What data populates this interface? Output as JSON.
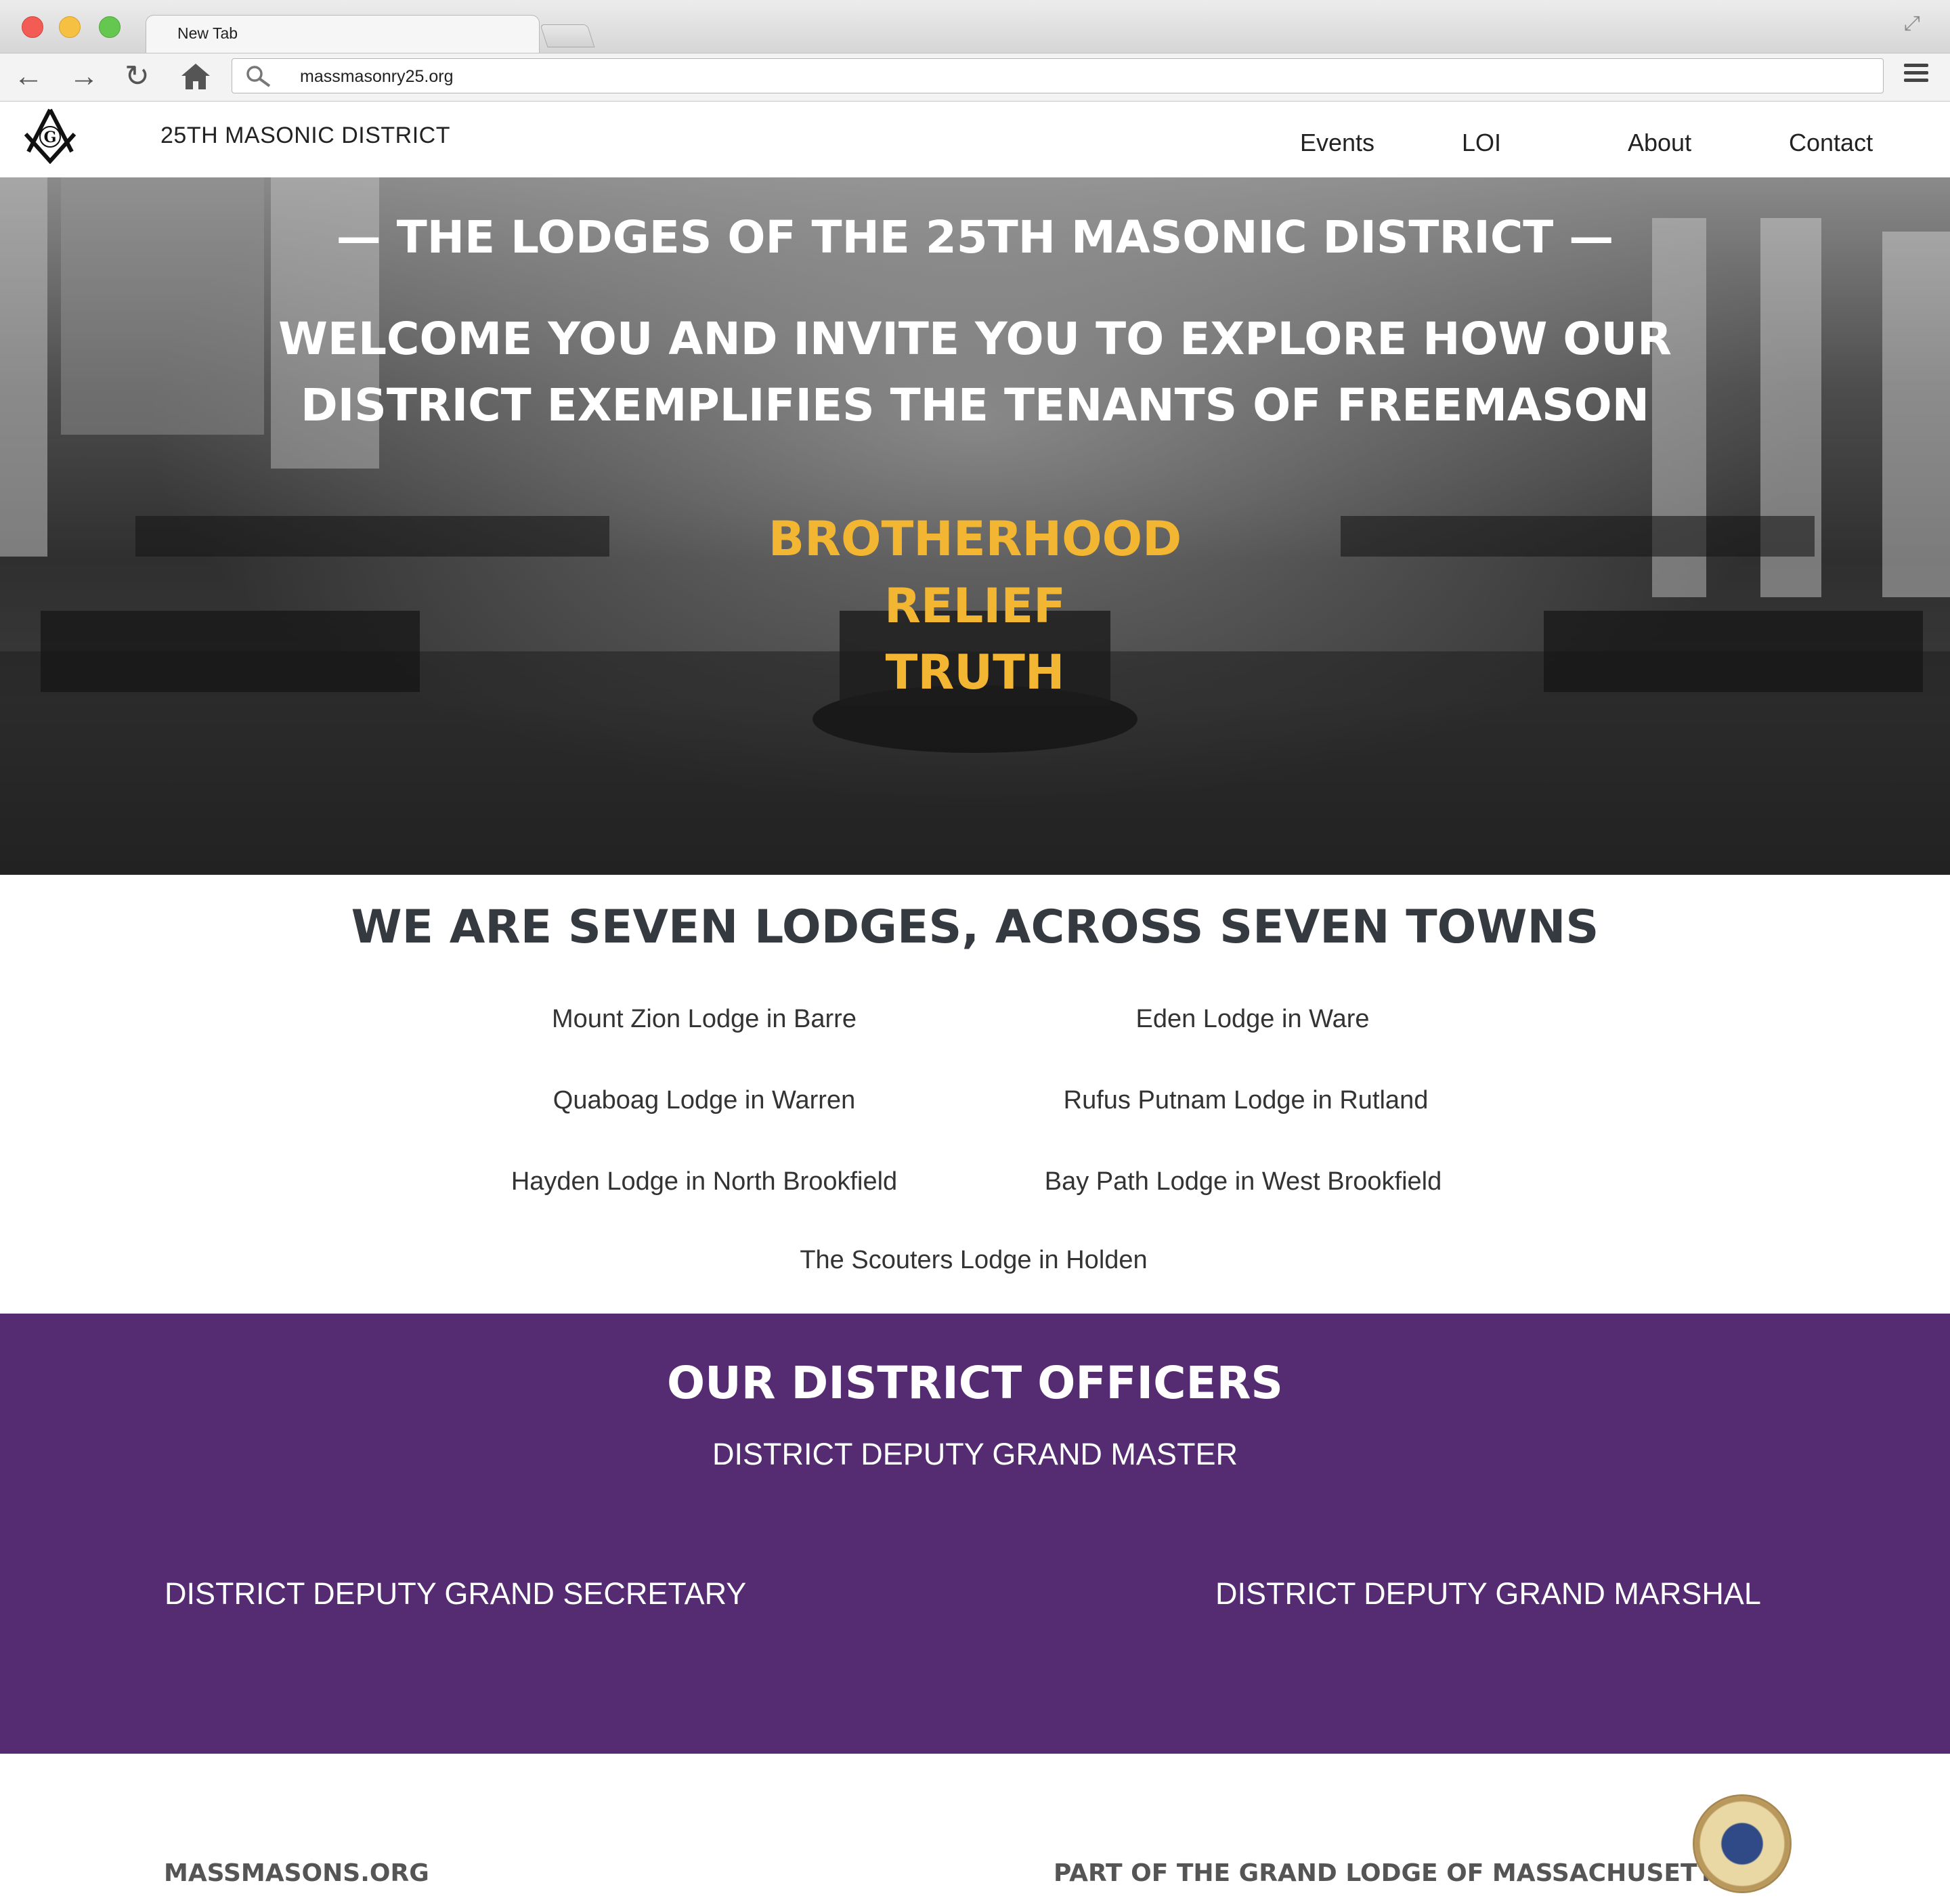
{
  "browser": {
    "tab_title": "New Tab",
    "url": "massmasonry25.org"
  },
  "site": {
    "title": "25TH MASONIC DISTRICT",
    "nav": [
      "Events",
      "LOI",
      "About",
      "Contact"
    ]
  },
  "hero": {
    "line1": "— THE LODGES OF THE 25TH MASONIC DISTRICT —",
    "line2": "WELCOME YOU AND INVITE YOU TO EXPLORE HOW OUR",
    "line3": "DISTRICT EXEMPLIFIES THE TENANTS OF FREEMASON",
    "tenets": [
      "BROTHERHOOD",
      "RELIEF",
      "TRUTH"
    ]
  },
  "lodges": {
    "heading": "WE ARE SEVEN LODGES, ACROSS SEVEN TOWNS",
    "items": [
      "Mount Zion Lodge in Barre",
      "Eden Lodge in Ware",
      "Quaboag Lodge in Warren",
      "Rufus Putnam Lodge in Rutland",
      "Hayden Lodge in North Brookfield",
      "Bay Path Lodge in West Brookfield",
      "The Scouters Lodge in Holden"
    ]
  },
  "officers": {
    "heading": "OUR DISTRICT OFFICERS",
    "master": "DISTRICT DEPUTY GRAND MASTER",
    "secretary": "DISTRICT DEPUTY GRAND SECRETARY",
    "marshal": "DISTRICT DEPUTY GRAND MARSHAL"
  },
  "footer": {
    "left_link": "MASSMASONS.ORG",
    "right_link": "PART OF THE GRAND LODGE OF MASSACHUSETTS"
  },
  "colors": {
    "officers_bg": "#552b72",
    "tenet_gold": "#f2b632",
    "heading_dark": "#343a40"
  },
  "icons": [
    "back-icon",
    "forward-icon",
    "reload-icon",
    "home-icon",
    "search-icon",
    "menu-icon",
    "square-compass-logo-icon",
    "grand-lodge-seal-icon"
  ]
}
